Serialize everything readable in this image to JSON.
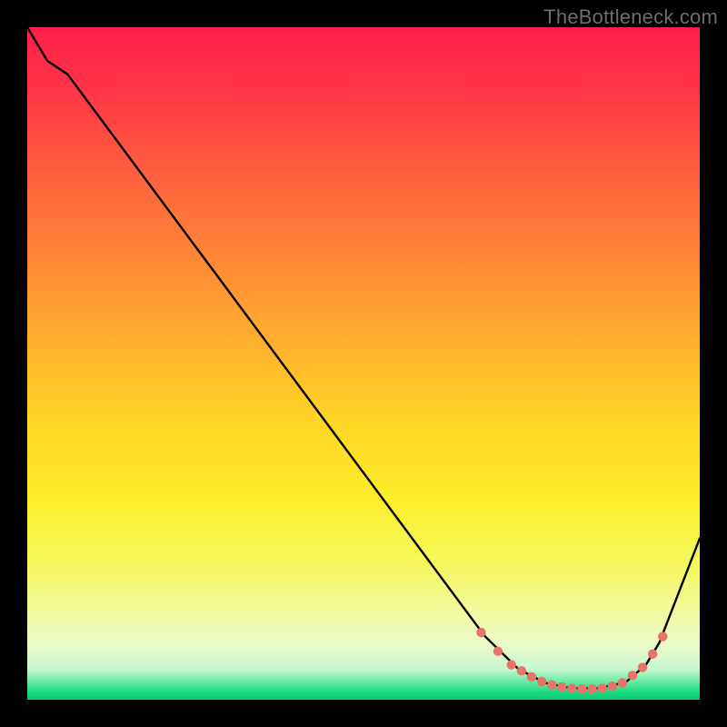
{
  "watermark": "TheBottleneck.com",
  "colors": {
    "background": "#000000",
    "curve": "#000000",
    "dot": "#e77369",
    "gradient_stops": [
      {
        "stop": 0.0,
        "color": "#ff1f49"
      },
      {
        "stop": 0.1,
        "color": "#ff3747"
      },
      {
        "stop": 0.2,
        "color": "#ff5a3f"
      },
      {
        "stop": 0.32,
        "color": "#ff8038"
      },
      {
        "stop": 0.45,
        "color": "#ffaa2f"
      },
      {
        "stop": 0.58,
        "color": "#ffd326"
      },
      {
        "stop": 0.7,
        "color": "#fcee2a"
      },
      {
        "stop": 0.8,
        "color": "#f5f85f"
      },
      {
        "stop": 0.88,
        "color": "#f1faa9"
      },
      {
        "stop": 0.92,
        "color": "#e9faca"
      },
      {
        "stop": 0.955,
        "color": "#c7f7cf"
      },
      {
        "stop": 0.975,
        "color": "#5de89c"
      },
      {
        "stop": 0.99,
        "color": "#19d880"
      },
      {
        "stop": 1.0,
        "color": "#07c972"
      }
    ]
  },
  "chart_data": {
    "type": "line",
    "title": "",
    "xlabel": "",
    "ylabel": "",
    "xlim": [
      0,
      100
    ],
    "ylim": [
      0,
      100
    ],
    "series": [
      {
        "name": "curve",
        "x": [
          0,
          3,
          6,
          68,
          73,
          77,
          81,
          85,
          89,
          92,
          94,
          100
        ],
        "y": [
          100,
          95,
          93,
          9.5,
          4.6,
          2.5,
          1.7,
          1.7,
          2.6,
          5.2,
          8.5,
          24
        ]
      }
    ],
    "markers": {
      "name": "highlight-dots",
      "x": [
        67.5,
        70,
        72,
        73.5,
        75,
        76.5,
        78,
        79.5,
        81,
        82.5,
        84,
        85.5,
        87,
        88.5,
        90,
        91.5,
        93,
        94.5
      ],
      "y": [
        10.0,
        7.2,
        5.2,
        4.3,
        3.4,
        2.7,
        2.2,
        1.9,
        1.7,
        1.6,
        1.6,
        1.7,
        2.0,
        2.5,
        3.6,
        4.8,
        6.8,
        9.4
      ]
    }
  }
}
